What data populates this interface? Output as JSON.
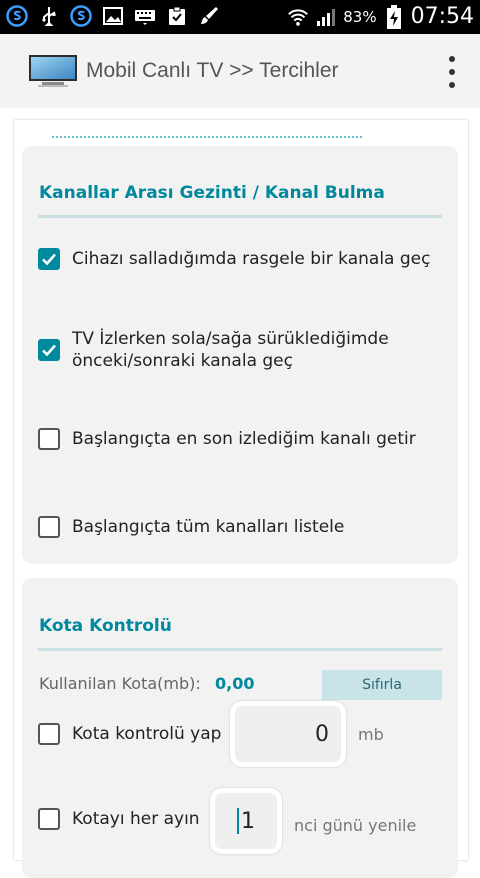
{
  "status_bar": {
    "left_icons": [
      "sync-icon",
      "usb-icon",
      "sync-icon",
      "image-icon",
      "keyboard-icon",
      "clipboard-icon",
      "brush-icon"
    ],
    "battery_percent": "83%",
    "time": "07:54"
  },
  "action_bar": {
    "title": "Mobil Canlı TV >> Tercihler",
    "menu_icon": "overflow-menu-icon"
  },
  "sections": {
    "navigation": {
      "title": "Kanallar Arası Gezinti / Kanal Bulma",
      "items": [
        {
          "label": "Cihazı salladığımda rasgele bir kanala geç",
          "checked": true
        },
        {
          "label": "TV İzlerken sola/sağa sürüklediğimde",
          "label2": "önceki/sonraki kanala geç",
          "checked": true
        },
        {
          "label": "Başlangıçta en son izlediğim kanalı getir",
          "checked": false
        },
        {
          "label": "Başlangıçta tüm kanalları listele",
          "checked": false
        }
      ]
    },
    "quota": {
      "title": "Kota Kontrolü",
      "used_label": "Kullanilan Kota(mb):",
      "used_value": "0,00",
      "reset_label": "Sıfırla",
      "control_label": "Kota kontrolü yap",
      "control_checked": false,
      "limit_value": "0",
      "limit_unit": "mb",
      "monthly_label": "Kotayı her ayın",
      "monthly_checked": false,
      "day_value": "1",
      "day_suffix": "nci günü yenile"
    }
  },
  "colors": {
    "accent": "#00899c",
    "section_bg": "#f2f2f2",
    "rule": "#c9dfe2"
  }
}
